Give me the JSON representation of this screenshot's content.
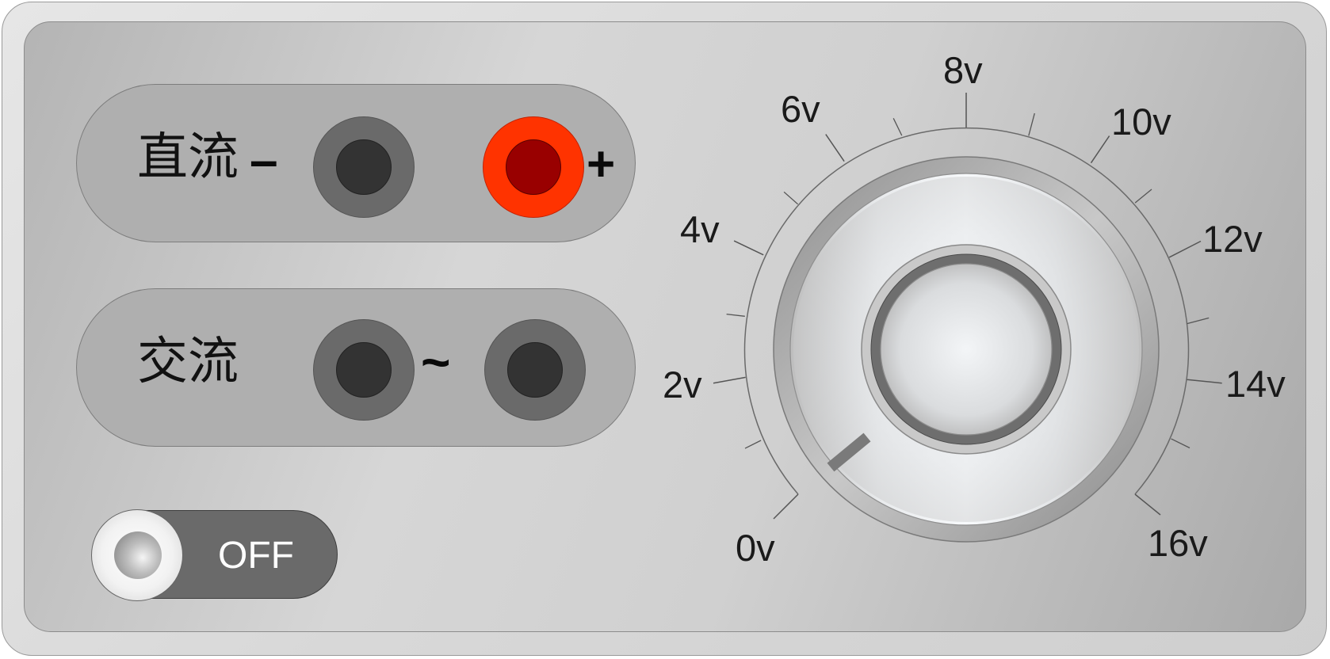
{
  "dc_panel": {
    "label": "直流",
    "negative_symbol": "–",
    "positive_symbol": "+"
  },
  "ac_panel": {
    "label": "交流",
    "tilde_symbol": "~"
  },
  "power_switch": {
    "state_label": "OFF"
  },
  "voltage_dial": {
    "scale_labels": [
      "0v",
      "2v",
      "4v",
      "6v",
      "8v",
      "10v",
      "12v",
      "14v",
      "16v"
    ],
    "selected_value_v": 0,
    "knob_indicator": "0v"
  },
  "colors": {
    "positive_terminal": "#ff3300",
    "positive_terminal_hole": "#990000",
    "neutral_terminal": "#6a6a6a",
    "terminal_hole": "#333333",
    "switch_body": "#6a6a6a",
    "switch_text": "#ffffff"
  }
}
